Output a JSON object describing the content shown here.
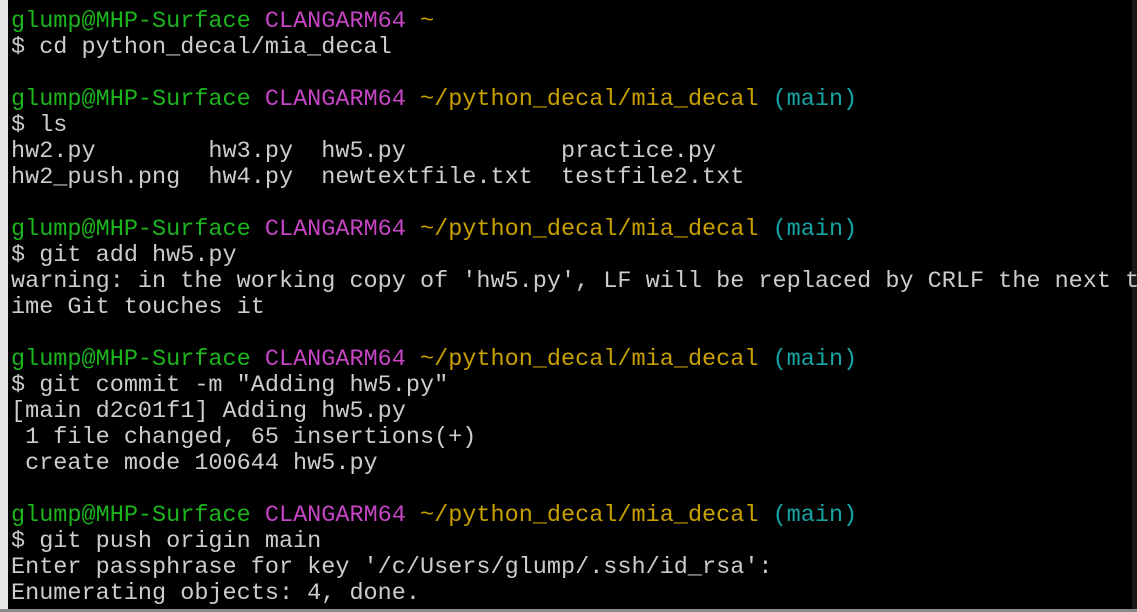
{
  "prompt": {
    "user": "glump@MHP-Surface",
    "env": "CLANGARM64",
    "home": "~",
    "cwd": "~/python_decal/mia_decal",
    "branch": "(main)"
  },
  "colors": {
    "user": "#1db51d",
    "env": "#c545c5",
    "path": "#c8a000",
    "branch": "#16a4a4",
    "text": "#cccccc",
    "background": "#000000"
  },
  "lines": [
    "$ cd python_decal/mia_decal",
    "$ ls",
    "hw2.py        hw3.py  hw5.py           practice.py",
    "hw2_push.png  hw4.py  newtextfile.txt  testfile2.txt",
    "$ git add hw5.py",
    "warning: in the working copy of 'hw5.py', LF will be replaced by CRLF the next t",
    "ime Git touches it",
    "$ git commit -m \"Adding hw5.py\"",
    "[main d2c01f1] Adding hw5.py",
    " 1 file changed, 65 insertions(+)",
    " create mode 100644 hw5.py",
    "$ git push origin main",
    "Enter passphrase for key '/c/Users/glump/.ssh/id_rsa':",
    "Enumerating objects: 4, done."
  ]
}
